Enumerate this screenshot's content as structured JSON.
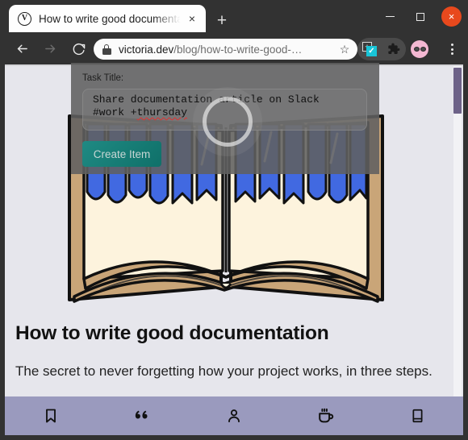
{
  "browser": {
    "tab": {
      "favicon_letter": "V",
      "favicon_name": "victoria-dev-favicon",
      "title": "How to write good documentation",
      "close_label": "×"
    },
    "new_tab_label": "+",
    "window_controls": {
      "minimize_label": "",
      "maximize_label": "",
      "close_label": "×"
    },
    "toolbar": {
      "back_label": "←",
      "forward_label": "→",
      "reload_label": "↻",
      "bookmark_star_label": "☆",
      "url_domain": "victoria.dev",
      "url_path": "/blog/how-to-write-good-…",
      "extension_plus_label": "+",
      "extension_check_label": "✓",
      "puzzle_label": "🧩",
      "menu_dots": "⋮"
    }
  },
  "modal": {
    "label": "Task Title:",
    "input_line1": "Share documentation article on Slack",
    "input_line2_prefix": "#work +",
    "input_line2_spellcheck": "thursday",
    "button_label": "Create Item",
    "loading": true
  },
  "page": {
    "hero_alt": "open-book-illustration",
    "heading": "How to write good documentation",
    "paragraph": "The secret to never forgetting how your project works, in three steps.",
    "bottom_nav": [
      {
        "name": "bookmark-icon",
        "label": "Bookmarks"
      },
      {
        "name": "quote-icon",
        "label": "Quotes"
      },
      {
        "name": "person-icon",
        "label": "About"
      },
      {
        "name": "coffee-icon",
        "label": "Support"
      },
      {
        "name": "book-icon",
        "label": "Reading"
      }
    ]
  },
  "colors": {
    "page_background": "#e6e6ec",
    "nav_background": "#9a9abe",
    "scrollbar_thumb": "#6d6288",
    "accent_button": "#0f7069",
    "browser_chrome": "#323232",
    "close_button": "#e8491d",
    "extension_accent": "#18c5d8",
    "avatar": "#f4b8d2"
  }
}
